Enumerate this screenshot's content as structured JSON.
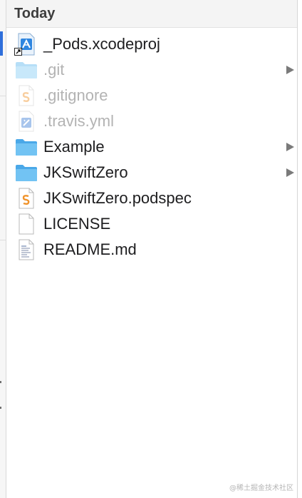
{
  "group": {
    "title": "Today"
  },
  "files": [
    {
      "name": "_Pods.xcodeproj",
      "icon": "xcodeproj-icon",
      "hidden": false,
      "folder": false
    },
    {
      "name": ".git",
      "icon": "folder-icon",
      "hidden": true,
      "folder": true
    },
    {
      "name": ".gitignore",
      "icon": "swift-file-icon",
      "hidden": true,
      "folder": false
    },
    {
      "name": ".travis.yml",
      "icon": "yml-file-icon",
      "hidden": true,
      "folder": false
    },
    {
      "name": "Example",
      "icon": "folder-icon",
      "hidden": false,
      "folder": true
    },
    {
      "name": "JKSwiftZero",
      "icon": "folder-icon",
      "hidden": false,
      "folder": true
    },
    {
      "name": "JKSwiftZero.podspec",
      "icon": "swift-file-icon",
      "hidden": false,
      "folder": false
    },
    {
      "name": "LICENSE",
      "icon": "blank-document-icon",
      "hidden": false,
      "folder": false
    },
    {
      "name": "README.md",
      "icon": "text-document-icon",
      "hidden": false,
      "folder": false
    }
  ],
  "watermark": "@稀土掘金技术社区",
  "colors": {
    "folder": "#5eb8ef",
    "selection": "#2f6fdb",
    "hidden_text": "#b3b3b3",
    "swift_orange": "#f0932b"
  }
}
